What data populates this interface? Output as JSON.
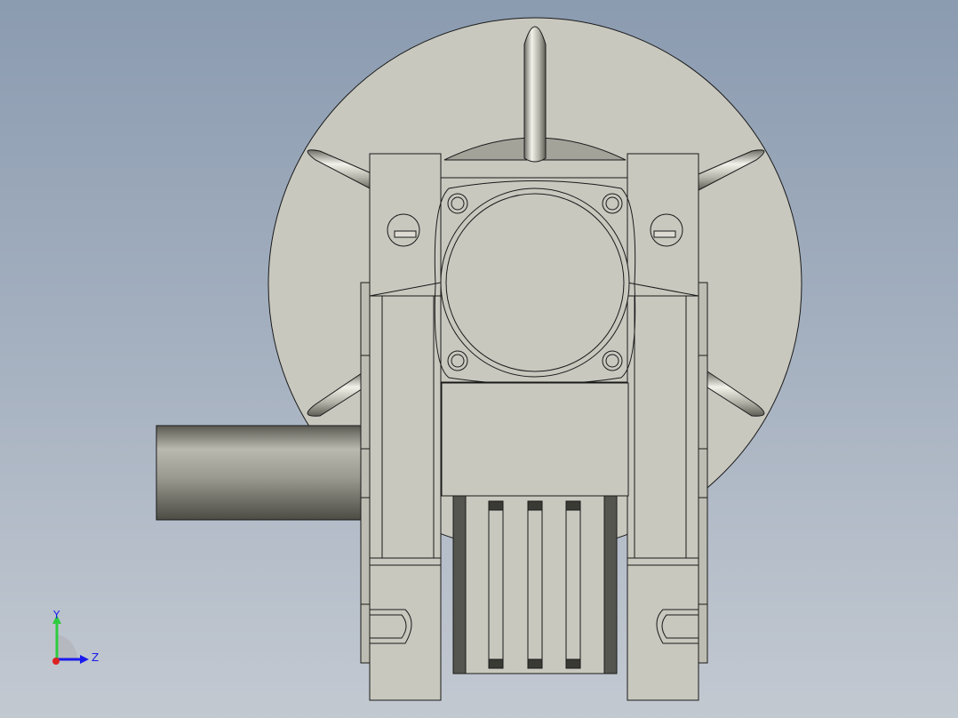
{
  "viewport": {
    "background_top": "#8b9bb0",
    "background_bottom": "#c3c9d1",
    "part_color": "#c8c8bf",
    "edge_color": "#1a1a1a",
    "shaft_color": "#8a8a80"
  },
  "triad": {
    "y_label": "Y",
    "z_label": "Z",
    "y_color": "#2ecc40",
    "z_color": "#1a1aee",
    "x_color": "#dd2222"
  }
}
